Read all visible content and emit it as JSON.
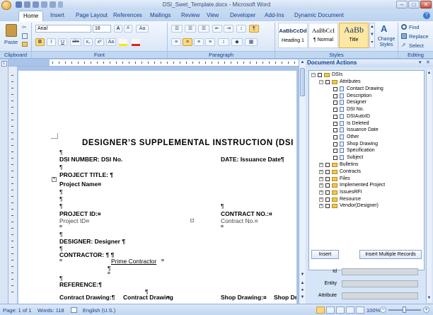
{
  "window": {
    "title": "DSI_Swet_Template.docx - Microsoft Word",
    "controls": [
      "–",
      "□",
      "✕"
    ]
  },
  "tabs": [
    "Home",
    "Insert",
    "Page Layout",
    "References",
    "Mailings",
    "Review",
    "View",
    "Developer",
    "Add-Ins",
    "Dynamic Document"
  ],
  "ribbon": {
    "clipboard": {
      "label": "Clipboard",
      "paste": "Paste"
    },
    "font": {
      "label": "Font",
      "family": "Arial",
      "size": "16",
      "grow": "A",
      "shrink": "A",
      "bold": "B",
      "italic": "I",
      "underline": "U",
      "strike": "abc",
      "sub": "x₂",
      "sup": "x²",
      "case": "Aa",
      "clear": "Aa"
    },
    "paragraph": {
      "label": "Paragraph",
      "pilcrow": "¶"
    },
    "styles": {
      "label": "Styles",
      "items": [
        {
          "preview": "AaBbCcDd",
          "name": "Heading 1"
        },
        {
          "preview": "AaBbCcI",
          "name": "¶ Normal"
        },
        {
          "preview": "AaBb",
          "name": "Title"
        }
      ],
      "change": "Change Styles"
    },
    "editing": {
      "label": "Editing",
      "find": "Find",
      "replace": "Replace",
      "select": "Select"
    }
  },
  "document": {
    "heading": "DESIGNER’S SUPPLEMENTAL INSTRUCTION (DSI",
    "lines": {
      "dsi_number": "DSI NUMBER: DSI No.",
      "date": "DATE: Issuance Date¶",
      "project_title": "PROJECT TITLE: ¶",
      "project_name": "Project Name¤",
      "project_id_label": "PROJECT ID:¤",
      "project_id_value": "Project ID¤",
      "contract_no_label": "CONTRACT NO.:¤",
      "contract_no_value": "Contract No.¤",
      "designer": "DESIGNER: Designer ¶",
      "contractor": "CONTRACTOR: ¶ ¶",
      "prime_contractor": "Prime Contractor",
      "reference": "REFERENCE:¶",
      "contract_drawing_label": "Contract Drawing:¶",
      "contract_drawing_value": "Contract Drawing",
      "shop_drawing_label": "Shop Drawing:¤",
      "shop_drawing_cut": "Shop Dra"
    },
    "pilcrow": "¶",
    "cell_marker": "¤"
  },
  "pane": {
    "title": "Document Actions",
    "tree": {
      "root": "DSIs",
      "attributes": "Attributes",
      "attribute_items": [
        "Contact Drawing",
        "Description",
        "Designer",
        "DSI No.",
        "DSIAutoID",
        "Is Deleted",
        "Issuance Date",
        "Other",
        "Shop Drawing",
        "Specification",
        "Subject"
      ],
      "folders": [
        "Bulletins",
        "Contracts",
        "Files",
        "Implemented Project",
        "IssuesRFI",
        "Resource",
        "Vendor(Designer)"
      ]
    },
    "buttons": {
      "insert": "Insert",
      "insert_multiple": "Insert Multiple Records"
    },
    "fields": [
      "Id",
      "Entity",
      "Attribute"
    ]
  },
  "status": {
    "page": "Page: 1 of 1",
    "words": "Words: 118",
    "language": "English (U.S.)",
    "zoom": "100%"
  }
}
